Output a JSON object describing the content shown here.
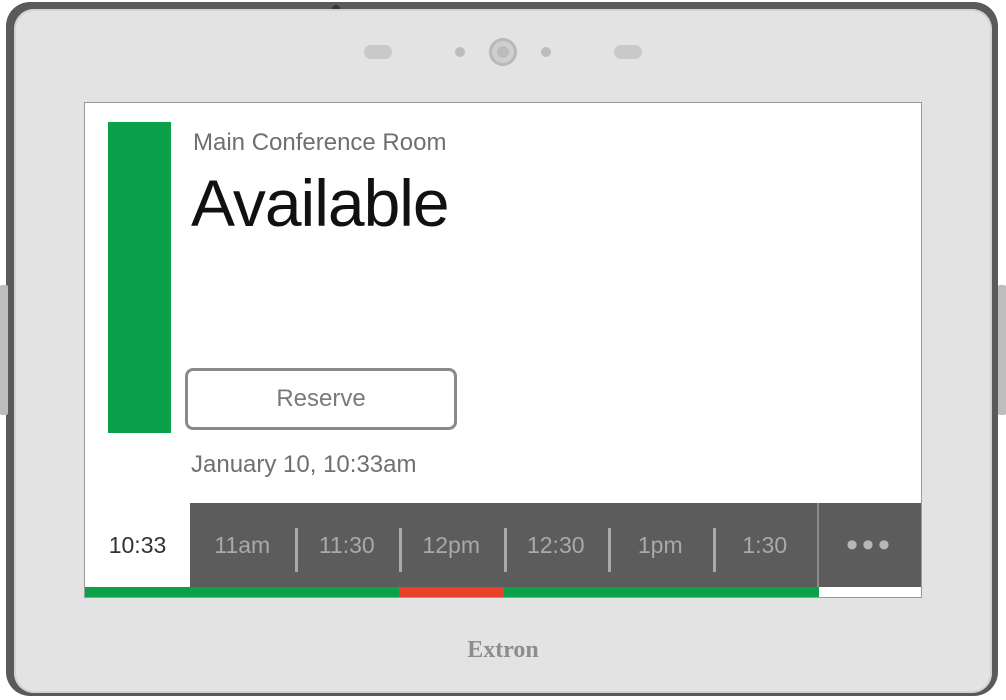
{
  "device": {
    "brand": "Extron"
  },
  "room": {
    "name": "Main Conference Room",
    "status": "Available",
    "status_color": "#0aa14a"
  },
  "actions": {
    "reserve_label": "Reserve"
  },
  "datetime": "January 10, 10:33am",
  "timeline": {
    "current_time": "10:33",
    "slots": [
      "11am",
      "11:30",
      "12pm",
      "12:30",
      "1pm",
      "1:30"
    ],
    "more_label": "•••",
    "occupancy": [
      {
        "state": "available",
        "color": "#0aa14a"
      },
      {
        "state": "booked",
        "color": "#e8402a"
      },
      {
        "state": "available",
        "color": "#0aa14a"
      }
    ]
  }
}
